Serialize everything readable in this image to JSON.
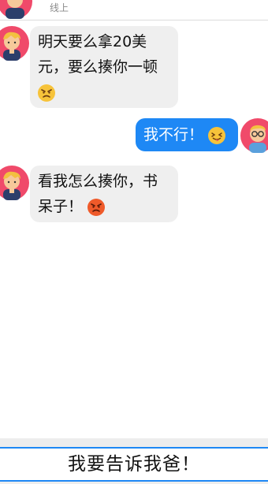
{
  "header": {
    "status": "线上",
    "avatar_icon": "boy-avatar-icon"
  },
  "messages": [
    {
      "side": "incoming",
      "avatar_icon": "boy-avatar-icon",
      "lines": [
        "明天要么拿20美",
        "元，要么揍你一顿"
      ],
      "emoji": "angry-face-icon"
    },
    {
      "side": "outgoing",
      "avatar_icon": "nerd-avatar-icon",
      "text": "我不行！",
      "emoji": "tongue-face-icon"
    },
    {
      "side": "incoming",
      "avatar_icon": "boy-avatar-icon",
      "lines": [
        "看我怎么揍你，书",
        "呆子！"
      ],
      "emoji": "red-angry-face-icon"
    }
  ],
  "reply_option": "我要告诉我爸！",
  "colors": {
    "accent": "#1e88f5",
    "incoming_bubble": "#efefef",
    "avatar_bg": "#f04a6a",
    "nerd_avatar_bg": "#f04a6a"
  }
}
